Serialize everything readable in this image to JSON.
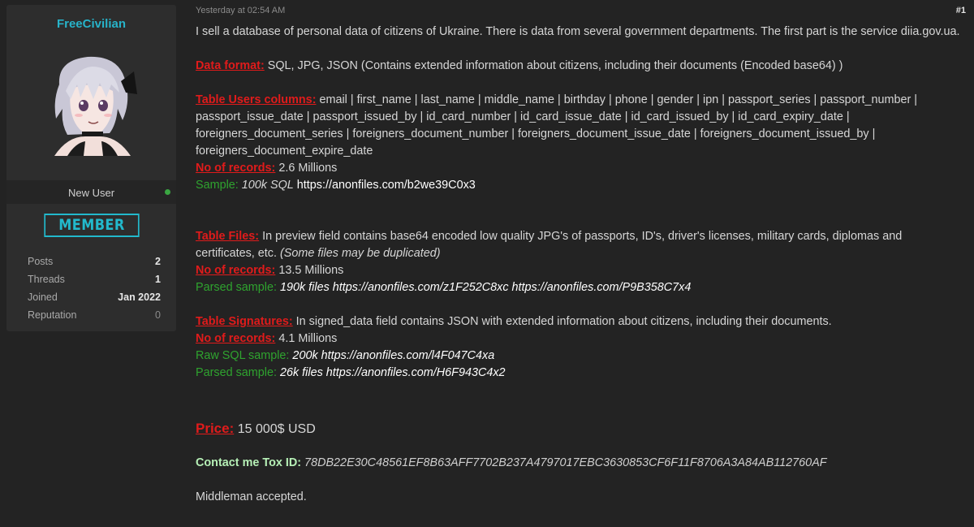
{
  "user": {
    "name": "FreeCivilian",
    "title": "New User",
    "badge": "MEMBER",
    "stats": [
      {
        "label": "Posts",
        "value": "2"
      },
      {
        "label": "Threads",
        "value": "1"
      },
      {
        "label": "Joined",
        "value": "Jan 2022"
      },
      {
        "label": "Reputation",
        "value": "0"
      }
    ]
  },
  "post": {
    "date": "Yesterday at 02:54 AM",
    "number": "#1",
    "intro": "I sell a database of personal data of citizens of Ukraine. There is data from several government departments. The first part is the service diia.gov.ua.",
    "data_format": {
      "label": "Data format:",
      "text": " SQL, JPG, JSON (Contains extended information about citizens, including their documents (Encoded base64) )"
    },
    "users": {
      "label": "Table Users columns:",
      "text": " email  | first_name | last_name | middle_name | birthday | phone | gender | ipn | passport_series | passport_number | passport_issue_date | passport_issued_by | id_card_number | id_card_issue_date | id_card_issued_by | id_card_expiry_date | foreigners_document_series | foreigners_document_number | foreigners_document_issue_date | foreigners_document_issued_by | foreigners_document_expire_date",
      "records_label": "No of records:",
      "records_value": " 2.6 Millions",
      "sample_label": "Sample:",
      "sample_size": " 100k SQL",
      "sample_link": " https://anonfiles.com/b2we39C0x3"
    },
    "files": {
      "label": "Table Files:",
      "text": " In preview field contains base64 encoded low quality JPG's of passports, ID's, driver's licenses, military cards, diplomas and certificates, etc.",
      "note": " (Some files may be duplicated)",
      "records_label": "No of records:",
      "records_value": " 13.5 Millions",
      "sample_label": "Parsed sample:",
      "sample_size": " 190k files",
      "sample_links": " https://anonfiles.com/z1F252C8xc https://anonfiles.com/P9B358C7x4"
    },
    "signatures": {
      "label": "Table Signatures:",
      "text": " In signed_data field contains JSON with extended information about citizens, including their documents.",
      "records_label": "No of records:",
      "records_value": " 4.1 Millions",
      "raw_label": "Raw SQL sample:",
      "raw_size": " 200k",
      "raw_link": " https://anonfiles.com/l4F047C4xa",
      "parsed_label": "Parsed sample:",
      "parsed_size": " 26k files",
      "parsed_link": " https://anonfiles.com/H6F943C4x2"
    },
    "price": {
      "label": "Price:",
      "value": " 15 000$ USD"
    },
    "contact": {
      "label": "Contact me Tox ID:",
      "tox_id": " 78DB22E30C48561EF8B63AFF7702B237A4797017EBC3630853CF6F11F8706A3A84AB112760AF"
    },
    "closing": "Middleman accepted."
  },
  "colors": {
    "background": "#232323",
    "card": "#2d2d2d",
    "accent_cyan": "#27b3c9",
    "label_red": "#e01b1b",
    "sample_green": "#2fa32f",
    "online_green": "#3aa642"
  },
  "icons": {
    "avatar": "anime-girl-avatar",
    "online": "online-status-dot"
  }
}
